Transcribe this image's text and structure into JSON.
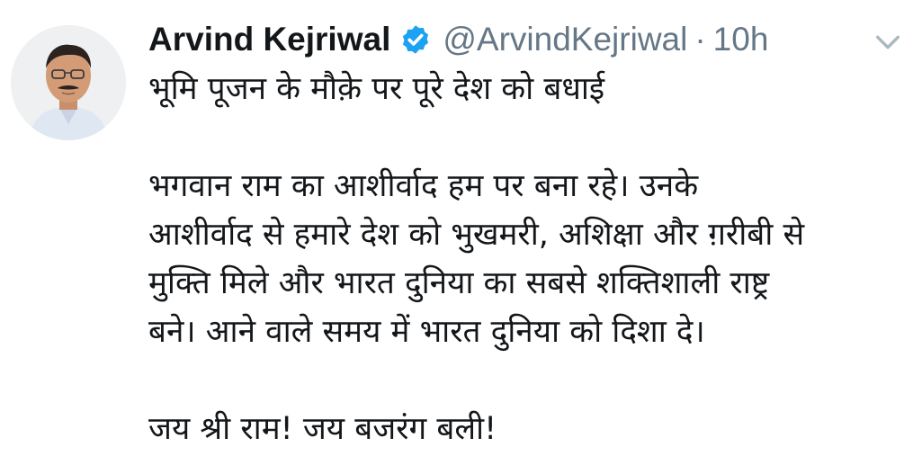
{
  "tweet": {
    "author_name": "Arvind Kejriwal",
    "handle": "@ArvindKejriwal",
    "separator": "·",
    "time": "10h",
    "lines": [
      "भूमि पूजन के मौक़े पर पूरे देश को बधाई",
      "भगवान राम का आशीर्वाद हम पर बना रहे। उनके",
      "आशीर्वाद से हमारे देश को भुखमरी, अशिक्षा और ग़रीबी से",
      "मुक्ति मिले और भारत दुनिया का सबसे शक्तिशाली राष्ट्र",
      "बने। आने वाले समय में भारत दुनिया को दिशा दे।",
      "जय श्री राम! जय बजरंग बली!"
    ]
  },
  "icons": {
    "verified": "verified-badge-icon",
    "menu": "chevron-down-icon"
  },
  "colors": {
    "text": "#14171a",
    "secondary": "#657786",
    "verified": "#1da1f2"
  }
}
